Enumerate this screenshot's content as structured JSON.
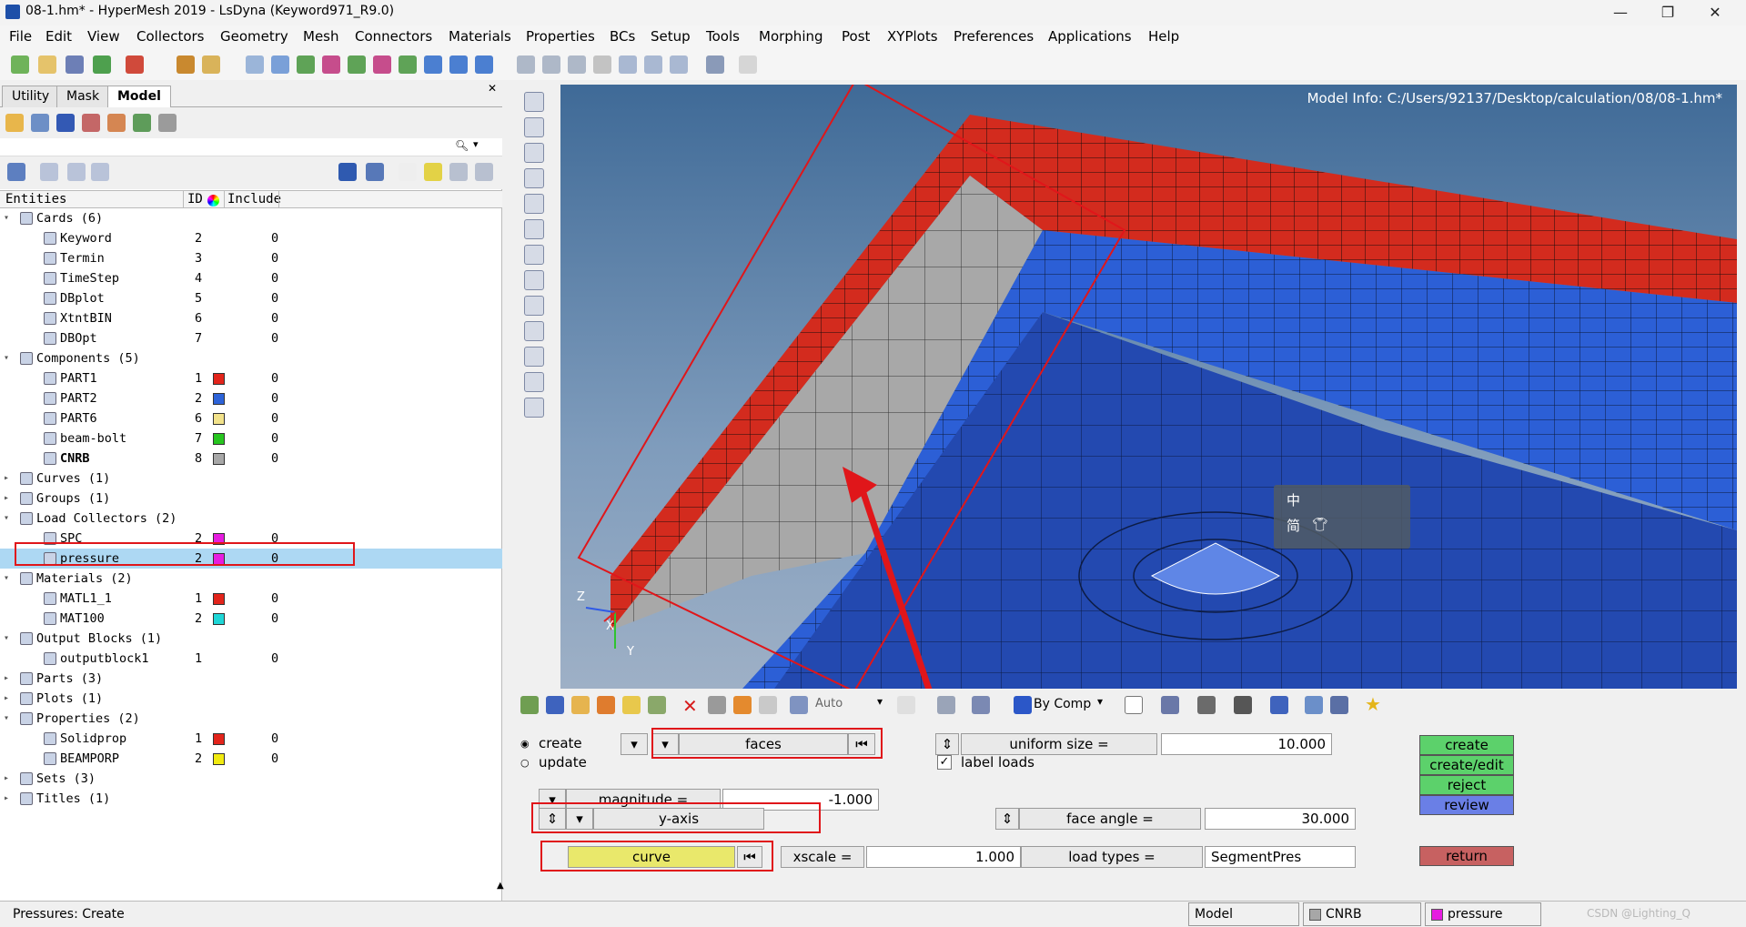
{
  "window": {
    "title": "08-1.hm* - HyperMesh 2019 - LsDyna (Keyword971_R9.0)"
  },
  "menu": [
    "File",
    "Edit",
    "View",
    "Collectors",
    "Geometry",
    "Mesh",
    "Connectors",
    "Materials",
    "Properties",
    "BCs",
    "Setup",
    "Tools",
    "Morphing",
    "Post",
    "XYPlots",
    "Preferences",
    "Applications",
    "Help"
  ],
  "tabs": [
    "Utility",
    "Mask",
    "Model"
  ],
  "tree_header": {
    "entities": "Entities",
    "id": "ID",
    "include": "Include"
  },
  "tree": [
    {
      "label": "Cards  (6)",
      "level": 0,
      "exp": "▾"
    },
    {
      "label": "Keyword",
      "level": 1,
      "id": "2",
      "inc": "0"
    },
    {
      "label": "Termin",
      "level": 1,
      "id": "3",
      "inc": "0"
    },
    {
      "label": "TimeStep",
      "level": 1,
      "id": "4",
      "inc": "0"
    },
    {
      "label": "DBplot",
      "level": 1,
      "id": "5",
      "inc": "0"
    },
    {
      "label": "XtntBIN",
      "level": 1,
      "id": "6",
      "inc": "0"
    },
    {
      "label": "DBOpt",
      "level": 1,
      "id": "7",
      "inc": "0"
    },
    {
      "label": "Components  (5)",
      "level": 0,
      "exp": "▾"
    },
    {
      "label": "PART1",
      "level": 1,
      "id": "1",
      "color": "#e3241b",
      "inc": "0"
    },
    {
      "label": "PART2",
      "level": 1,
      "id": "2",
      "color": "#2d63d8",
      "inc": "0"
    },
    {
      "label": "PART6",
      "level": 1,
      "id": "6",
      "color": "#f2e28a",
      "inc": "0"
    },
    {
      "label": "beam-bolt",
      "level": 1,
      "id": "7",
      "color": "#27c51f",
      "inc": "0"
    },
    {
      "label": "CNRB",
      "level": 1,
      "id": "8",
      "color": "#a7a7a7",
      "inc": "0",
      "bold": true
    },
    {
      "label": "Curves  (1)",
      "level": 0,
      "exp": "▸"
    },
    {
      "label": "Groups  (1)",
      "level": 0,
      "exp": "▸"
    },
    {
      "label": "Load Collectors  (2)",
      "level": 0,
      "exp": "▾"
    },
    {
      "label": "SPC",
      "level": 1,
      "id": "2",
      "color": "#e61ce0",
      "inc": "0"
    },
    {
      "label": "pressure",
      "level": 1,
      "id": "2",
      "color": "#e61ce0",
      "inc": "0",
      "selected": true
    },
    {
      "label": "Materials  (2)",
      "level": 0,
      "exp": "▾"
    },
    {
      "label": "MATL1_1",
      "level": 1,
      "id": "1",
      "color": "#e3241b",
      "inc": "0"
    },
    {
      "label": "MAT100",
      "level": 1,
      "id": "2",
      "color": "#1ed6d6",
      "inc": "0"
    },
    {
      "label": "Output Blocks  (1)",
      "level": 0,
      "exp": "▾"
    },
    {
      "label": "outputblock1",
      "level": 1,
      "id": "1",
      "inc": "0"
    },
    {
      "label": "Parts  (3)",
      "level": 0,
      "exp": "▸"
    },
    {
      "label": "Plots  (1)",
      "level": 0,
      "exp": "▸"
    },
    {
      "label": "Properties  (2)",
      "level": 0,
      "exp": "▾"
    },
    {
      "label": "Solidprop",
      "level": 1,
      "id": "1",
      "color": "#e3241b",
      "inc": "0"
    },
    {
      "label": "BEAMPORP",
      "level": 1,
      "id": "2",
      "color": "#f1ea10",
      "inc": "0"
    },
    {
      "label": "Sets  (3)",
      "level": 0,
      "exp": "▸"
    },
    {
      "label": "Titles  (1)",
      "level": 0,
      "exp": "▸"
    }
  ],
  "viewport": {
    "model_info": "Model Info: C:/Users/92137/Desktop/calculation/08/08-1.hm*",
    "axes": {
      "z": "Z",
      "x": "X",
      "y": "Y"
    },
    "ime": {
      "char1": "中",
      "char2": "简"
    }
  },
  "bottom_toolbar": {
    "auto": "Auto",
    "by_comp": "By Comp"
  },
  "panel": {
    "create": "create",
    "update": "update",
    "faces": "faces",
    "uniform_size_label": "uniform size =",
    "uniform_size_value": "10.000",
    "label_loads": "label loads",
    "magnitude_label": "magnitude =",
    "magnitude_value": "-1.000",
    "direction": "y-axis",
    "face_angle_label": "face angle =",
    "face_angle_value": "30.000",
    "curve": "curve",
    "xscale_label": "xscale =",
    "xscale_value": "1.000",
    "load_types_label": "load types =",
    "load_types_value": "SegmentPres",
    "buttons": {
      "create": "create",
      "create_edit": "create/edit",
      "reject": "reject",
      "review": "review",
      "return": "return"
    }
  },
  "status": {
    "message": "Pressures:  Create",
    "model": "Model",
    "component": "CNRB",
    "loadcol": "pressure",
    "watermark": "CSDN @Lighting_Q"
  },
  "colors": {
    "red": "#e3241b",
    "blue": "#2d63d8",
    "gray": "#a6a6a6",
    "green_btn": "#5cd16b",
    "blue_btn": "#6a7fe6",
    "return_btn": "#c76161",
    "yellow": "#e9e86b"
  }
}
